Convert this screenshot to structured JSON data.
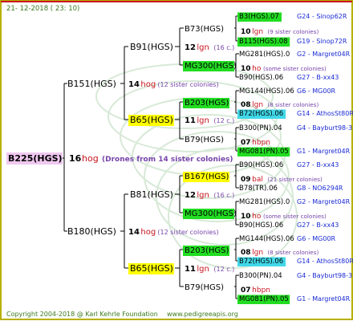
{
  "header": {
    "date": "21- 12-2018 ( 23: 10)"
  },
  "footer": {
    "copyright": "Copyright 2004-2018 @ Karl Kehrle Foundation",
    "website": "www.pedigreeapis.org"
  },
  "colors": {
    "frame": "#b8b000",
    "lines": "#000000",
    "root_bg": "#f0c8f0",
    "green": "#22dd22",
    "yellow": "#ffff00",
    "cyan": "#40d8e8",
    "hog_red": "#c8141e",
    "link_blue": "#1a2ad4",
    "note_purple": "#7744aa",
    "footer_green": "#3b7a1e"
  },
  "root": {
    "label": "B225(HGS)",
    "num": "16",
    "hog": "hog",
    "note": "(Drones from 14 sister colonies)"
  },
  "branches": [
    {
      "label": "B151(HGS)",
      "num": "14",
      "hog": "hog",
      "note": "(12 sister colonies)",
      "children": [
        {
          "label": "B91(HGS)",
          "num": "12",
          "hog": "lgn",
          "note": "(16 c.)",
          "children": [
            {
              "label": "B73(HGS)",
              "num": "10",
              "hog": "lgn",
              "note": "(9 sister colonies)",
              "children": [
                {
                  "label": "B3(HGS).07",
                  "tag": "G24 - Sinop62R"
                },
                {
                  "label": "B115(HGS).08",
                  "tag": "G19 - Sinop72R"
                }
              ]
            },
            {
              "label": "MG300(HGS)",
              "num": "10",
              "hog": "ho",
              "note": "(some sister colonies)",
              "children": [
                {
                  "label": "MG281(HGS).0",
                  "tag": "G2 - Margret04R"
                },
                {
                  "label": "B90(HGS).06",
                  "tag": "G27 - B-xx43"
                }
              ]
            }
          ]
        },
        {
          "label": "B65(HGS)",
          "num": "11",
          "hog": "lgn",
          "note": "(12 c.)",
          "children": [
            {
              "label": "B203(HGS)",
              "num": "08",
              "hog": "lgn",
              "note": "(8 sister colonies)",
              "children": [
                {
                  "label": "MG144(HGS).06",
                  "tag": "G6 - MG00R"
                },
                {
                  "label": "B72(HGS).06",
                  "tag": "G14 - AthosSt80R"
                }
              ]
            },
            {
              "label": "B79(HGS)",
              "num": "07",
              "hog": "hbpn",
              "note": "",
              "children": [
                {
                  "label": "B300(PN).04",
                  "tag": "G4 - Bayburt98-3"
                },
                {
                  "label": "MG081(PN).05",
                  "tag": "G1 - Margret04R"
                }
              ]
            }
          ]
        }
      ]
    },
    {
      "label": "B180(HGS)",
      "num": "14",
      "hog": "hog",
      "note": "(12 sister colonies)",
      "children": [
        {
          "label": "B81(HGS)",
          "num": "12",
          "hog": "lgn",
          "note": "(16 c.)",
          "children": [
            {
              "label": "B167(HGS)",
              "num": "09",
              "hog": "bal",
              "note": "(21 sister colonies)",
              "children": [
                {
                  "label": "B90(HGS).06",
                  "tag": "G27 - B-xx43"
                },
                {
                  "label": "B78(TR).06",
                  "tag": "G8 - NO6294R"
                }
              ]
            },
            {
              "label": "MG300(HGS)",
              "num": "10",
              "hog": "ho",
              "note": "(some sister colonies)",
              "children": [
                {
                  "label": "MG281(HGS).0",
                  "tag": "G2 - Margret04R"
                },
                {
                  "label": "B90(HGS).06",
                  "tag": "G27 - B-xx43"
                }
              ]
            }
          ]
        },
        {
          "label": "B65(HGS)",
          "num": "11",
          "hog": "lgn",
          "note": "(12 c.)",
          "children": [
            {
              "label": "B203(HGS)",
              "num": "08",
              "hog": "lgn",
              "note": "(8 sister colonies)",
              "children": [
                {
                  "label": "MG144(HGS).06",
                  "tag": "G6 - MG00R"
                },
                {
                  "label": "B72(HGS).06",
                  "tag": "G14 - AthosSt80R"
                }
              ]
            },
            {
              "label": "B79(HGS)",
              "num": "07",
              "hog": "hbpn",
              "note": "",
              "children": [
                {
                  "label": "B300(PN).04",
                  "tag": "G4 - Bayburt98-3"
                },
                {
                  "label": "MG081(PN).05",
                  "tag": "G1 - Margret04R"
                }
              ]
            }
          ]
        }
      ]
    }
  ]
}
